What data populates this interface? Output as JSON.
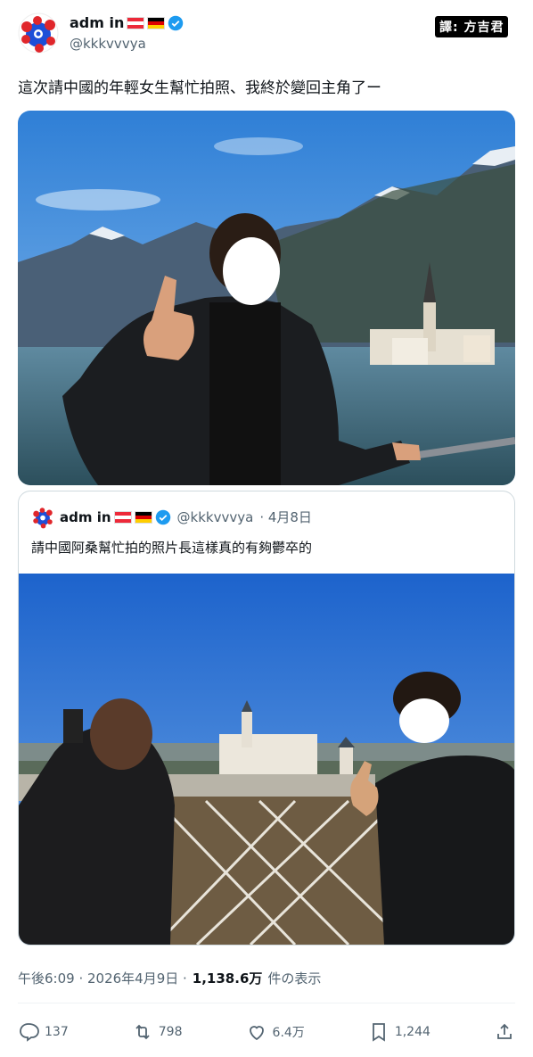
{
  "author": {
    "name": "adm in",
    "handle": "@kkkvvvya",
    "credit": "譯: 方吉君"
  },
  "tweet": {
    "text": "這次請中國的年輕女生幫忙拍照、我終於變回主角了ー"
  },
  "quoted": {
    "name": "adm in",
    "handle": "@kkkvvvya",
    "date": "· 4月8日",
    "text": "請中國阿桑幫忙拍的照片長這樣真的有夠鬱卒的"
  },
  "meta": {
    "time": "午後6:09 · 2026年4月9日 ·",
    "views": "1,138.6万",
    "views_suffix": "件の表示"
  },
  "actions": {
    "reply": "137",
    "retweet": "798",
    "like": "6.4万",
    "bookmark": "1,244"
  },
  "colors": {
    "verified": "#1d9bf0",
    "text_secondary": "#536471"
  }
}
